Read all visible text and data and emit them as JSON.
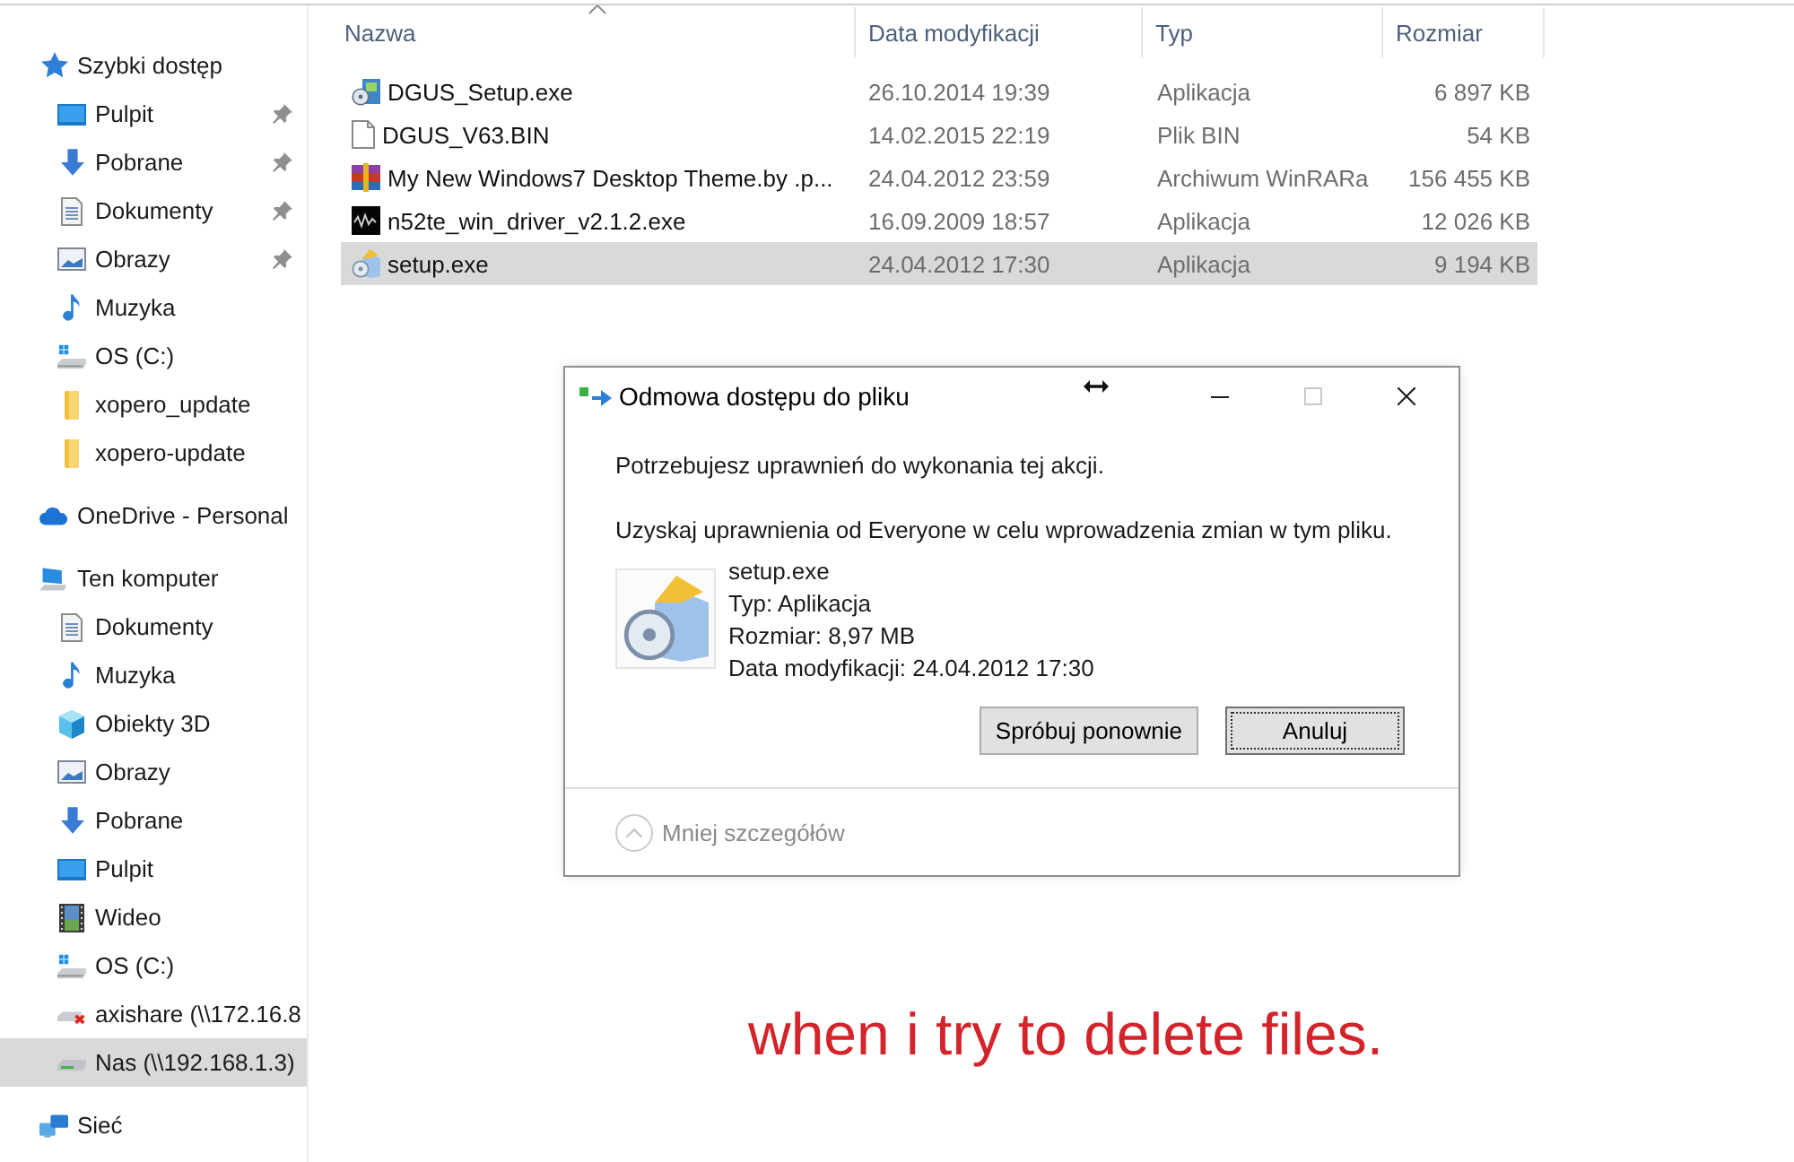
{
  "sidebar": {
    "items": [
      {
        "label": "Szybki dostęp",
        "kind": "quick-access",
        "selected": false,
        "children": [
          {
            "label": "Pulpit",
            "kind": "desktop",
            "pinned": true,
            "selected": false
          },
          {
            "label": "Pobrane",
            "kind": "downloads",
            "pinned": true,
            "selected": false
          },
          {
            "label": "Dokumenty",
            "kind": "documents",
            "pinned": true,
            "selected": false
          },
          {
            "label": "Obrazy",
            "kind": "pictures",
            "pinned": true,
            "selected": false
          },
          {
            "label": "Muzyka",
            "kind": "music",
            "pinned": false,
            "selected": false
          },
          {
            "label": "OS (C:)",
            "kind": "drive",
            "pinned": false,
            "selected": false
          },
          {
            "label": "xopero_update",
            "kind": "folder",
            "pinned": false,
            "selected": false
          },
          {
            "label": "xopero-update",
            "kind": "folder",
            "pinned": false,
            "selected": false
          }
        ]
      },
      {
        "label": "OneDrive - Personal",
        "kind": "cloud",
        "selected": false
      },
      {
        "label": "Ten komputer",
        "kind": "computer",
        "selected": false,
        "children": [
          {
            "label": "Dokumenty",
            "kind": "documents",
            "selected": false
          },
          {
            "label": "Muzyka",
            "kind": "music",
            "selected": false
          },
          {
            "label": "Obiekty 3D",
            "kind": "objects",
            "selected": false
          },
          {
            "label": "Obrazy",
            "kind": "pictures",
            "selected": false
          },
          {
            "label": "Pobrane",
            "kind": "downloads",
            "selected": false
          },
          {
            "label": "Pulpit",
            "kind": "desktop",
            "selected": false
          },
          {
            "label": "Wideo",
            "kind": "videos",
            "selected": false
          },
          {
            "label": "OS (C:)",
            "kind": "drive",
            "selected": false
          },
          {
            "label": "axishare (\\\\172.16.8",
            "kind": "network-drive-disconnected",
            "selected": false
          },
          {
            "label": "Nas (\\\\192.168.1.3)",
            "kind": "network-drive",
            "selected": true
          }
        ]
      },
      {
        "label": "Sieć",
        "kind": "network",
        "selected": false
      }
    ]
  },
  "file_list": {
    "columns": [
      {
        "label": "Nazwa",
        "sorted": true
      },
      {
        "label": "Data modyfikacji",
        "sorted": false
      },
      {
        "label": "Typ",
        "sorted": false
      },
      {
        "label": "Rozmiar",
        "sorted": false
      }
    ],
    "rows": [
      {
        "name": "DGUS_Setup.exe",
        "kind": "installer",
        "modified": "26.10.2014 19:39",
        "type": "Aplikacja",
        "size": "6 897 KB",
        "selected": false
      },
      {
        "name": "DGUS_V63.BIN",
        "kind": "file",
        "modified": "14.02.2015 22:19",
        "type": "Plik BIN",
        "size": "54 KB",
        "selected": false
      },
      {
        "name": "My New Windows7 Desktop Theme.by .p...",
        "kind": "archive",
        "modified": "24.04.2012 23:59",
        "type": "Archiwum WinRARa",
        "size": "156 455 KB",
        "selected": false
      },
      {
        "name": "n52te_win_driver_v2.1.2.exe",
        "kind": "driver-app",
        "modified": "16.09.2009 18:57",
        "type": "Aplikacja",
        "size": "12 026 KB",
        "selected": false
      },
      {
        "name": "setup.exe",
        "kind": "setup",
        "modified": "24.04.2012 17:30",
        "type": "Aplikacja",
        "size": "9 194 KB",
        "selected": true
      }
    ]
  },
  "dialog": {
    "title": "Odmowa dostępu do pliku",
    "window_controls": [
      {
        "kind": "minimize",
        "disabled": false
      },
      {
        "kind": "maximize",
        "disabled": true
      },
      {
        "kind": "close",
        "disabled": false
      }
    ],
    "message": "Potrzebujesz uprawnień do wykonania tej akcji.",
    "instruction": "Uzyskaj uprawnienia od Everyone w celu wprowadzenia zmian w tym pliku.",
    "file": {
      "kind": "setup",
      "name": "setup.exe",
      "type": "Typ: Aplikacja",
      "size": "Rozmiar: 8,97 MB",
      "modified": "Data modyfikacji: 24.04.2012 17:30"
    },
    "buttons": [
      {
        "label": "Spróbuj ponownie",
        "focused": false
      },
      {
        "label": "Anuluj",
        "focused": true
      }
    ],
    "details_toggle": {
      "label": "Mniej szczegółów",
      "expanded": true
    }
  },
  "annotation": {
    "text": "when i try to delete files."
  }
}
